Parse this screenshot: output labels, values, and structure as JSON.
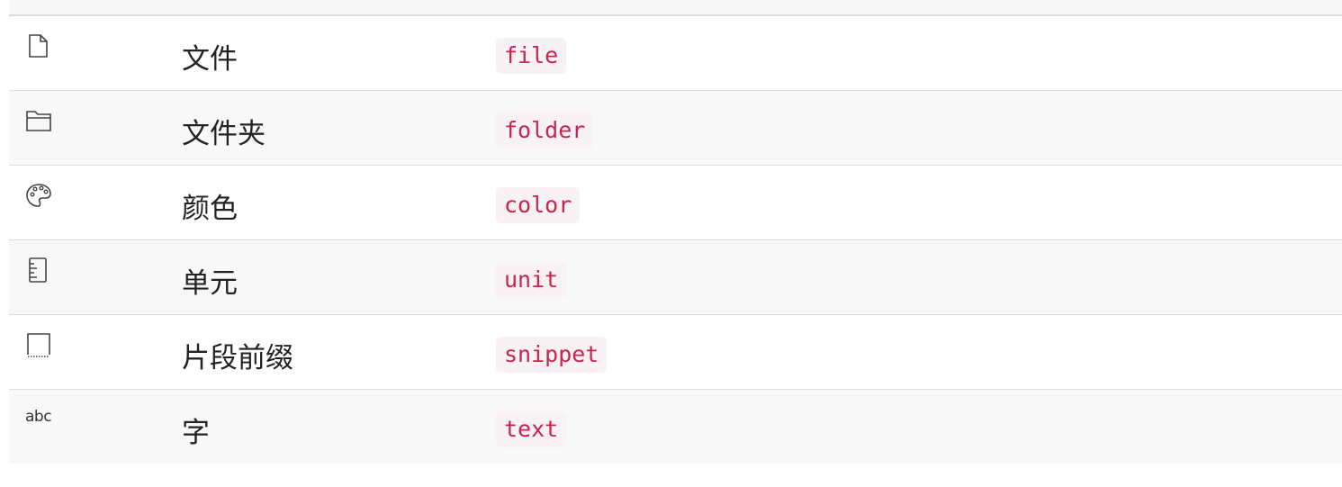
{
  "rows": [
    {
      "icon": "file-icon",
      "name": "文件",
      "code": "file"
    },
    {
      "icon": "folder-icon",
      "name": "文件夹",
      "code": "folder"
    },
    {
      "icon": "palette-icon",
      "name": "颜色",
      "code": "color"
    },
    {
      "icon": "ruler-icon",
      "name": "单元",
      "code": "unit"
    },
    {
      "icon": "snippet-icon",
      "name": "片段前缀",
      "code": "snippet"
    },
    {
      "icon": "text-icon",
      "name": "字",
      "code": "text",
      "icon_text": "abc"
    }
  ],
  "colors": {
    "code_text": "#c7254e",
    "code_bg": "#f9f2f4",
    "row_alt_bg": "#f8f8f8",
    "border": "#dddddd"
  }
}
